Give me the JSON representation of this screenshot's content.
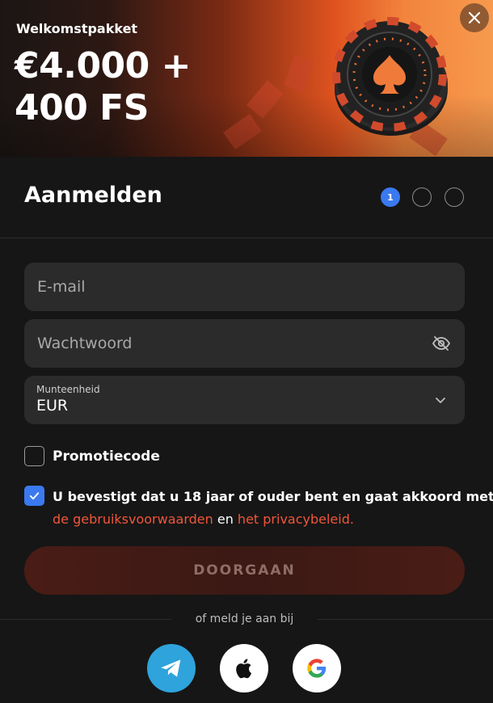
{
  "banner": {
    "eyebrow": "Welkomstpakket",
    "title_line1": "€4.000 +",
    "title_line2": "400 FS"
  },
  "header": {
    "title": "Aanmelden",
    "steps": [
      {
        "label": "1",
        "active": true
      },
      {
        "label": "",
        "active": false
      },
      {
        "label": "",
        "active": false
      }
    ]
  },
  "form": {
    "email_placeholder": "E-mail",
    "password_placeholder": "Wachtwoord",
    "currency_label": "Munteenheid",
    "currency_value": "EUR"
  },
  "promo": {
    "label": "Promotiecode",
    "checked": false
  },
  "terms": {
    "checked": true,
    "line1": "U bevestigt dat u 18 jaar of ouder bent en gaat akkoord met",
    "link_terms": "de gebruiksvoorwaarden",
    "connector": " en ",
    "link_privacy": "het privacybeleid."
  },
  "continue_label": "DOORGAAN",
  "social": {
    "divider_text": "of meld je aan bij",
    "providers": [
      "telegram",
      "apple",
      "google"
    ]
  },
  "colors": {
    "accent_blue": "#3a79ef",
    "link_red": "#f0563a",
    "background": "#161616",
    "field": "#2b2b2b",
    "telegram": "#2ea3dc"
  },
  "icons": {
    "close": "close-icon",
    "eye": "eye-off-icon",
    "chevron": "chevron-down-icon",
    "check": "check-icon"
  }
}
